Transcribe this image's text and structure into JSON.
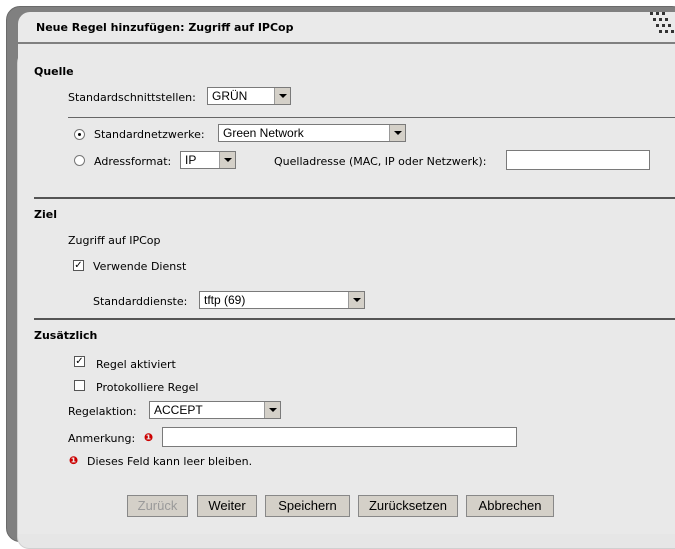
{
  "dialog": {
    "title": "Neue Regel hinzufügen: Zugriff auf IPCop"
  },
  "source": {
    "heading": "Quelle",
    "interfaces_label": "Standardschnittstellen:",
    "interfaces_value": "GRÜN",
    "networks_label": "Standardnetzwerke:",
    "networks_value": "Green Network",
    "addressformat_label": "Adressformat:",
    "addressformat_value": "IP",
    "source_address_label": "Quelladresse (MAC, IP oder Netzwerk):",
    "source_address_value": ""
  },
  "destination": {
    "heading": "Ziel",
    "access_label": "Zugriff auf IPCop",
    "use_service_label": "Verwende Dienst",
    "services_label": "Standarddienste:",
    "services_value": "tftp (69)"
  },
  "extra": {
    "heading": "Zusätzlich",
    "rule_enabled_label": "Regel aktiviert",
    "log_rule_label": "Protokolliere Regel",
    "action_label": "Regelaktion:",
    "action_value": "ACCEPT",
    "remark_label": "Anmerkung:",
    "remark_value": "",
    "optional_note": "Dieses Feld kann leer bleiben.",
    "info_glyph": "❶"
  },
  "buttons": {
    "back": "Zurück",
    "next": "Weiter",
    "save": "Speichern",
    "reset": "Zurücksetzen",
    "cancel": "Abbrechen"
  }
}
